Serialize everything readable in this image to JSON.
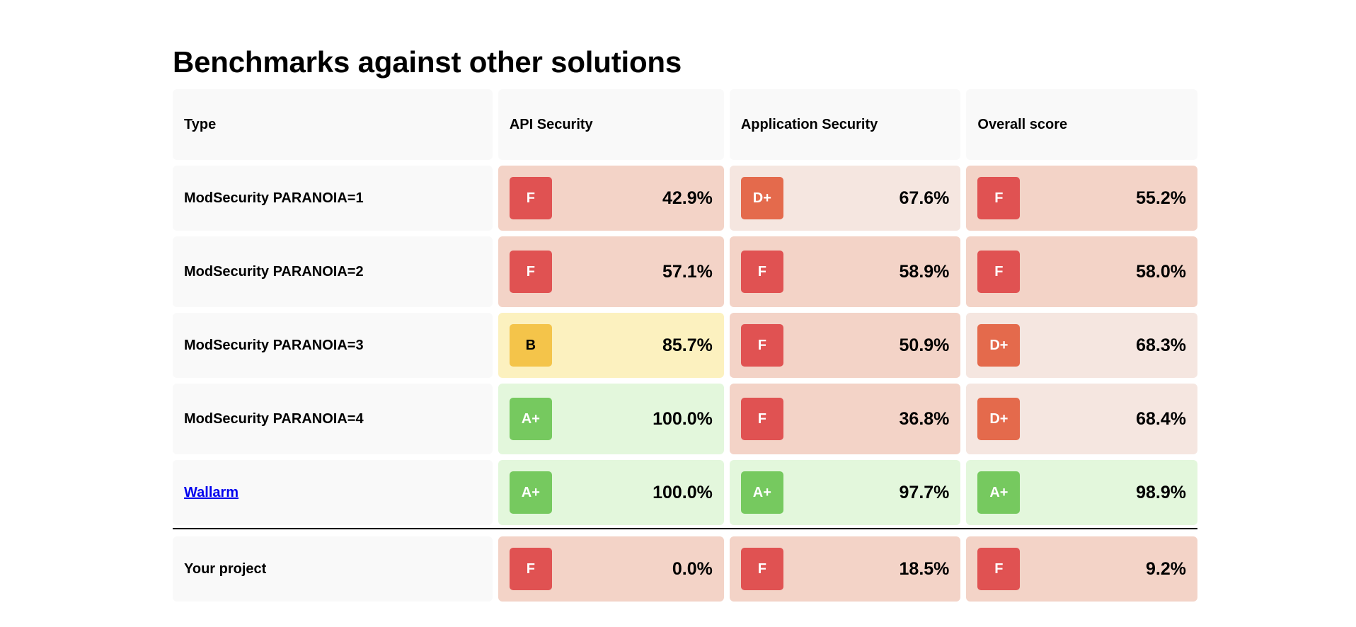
{
  "title": "Benchmarks against other solutions",
  "columns": [
    "Type",
    "API Security",
    "Application Security",
    "Overall score"
  ],
  "rows": [
    {
      "type": "ModSecurity PARANOIA=1",
      "api": {
        "grade": "F",
        "pct": "42.9%"
      },
      "app": {
        "grade": "D+",
        "pct": "67.6%"
      },
      "overall": {
        "grade": "F",
        "pct": "55.2%"
      }
    },
    {
      "type": "ModSecurity PARANOIA=2",
      "api": {
        "grade": "F",
        "pct": "57.1%"
      },
      "app": {
        "grade": "F",
        "pct": "58.9%"
      },
      "overall": {
        "grade": "F",
        "pct": "58.0%"
      }
    },
    {
      "type": "ModSecurity PARANOIA=3",
      "api": {
        "grade": "B",
        "pct": "85.7%"
      },
      "app": {
        "grade": "F",
        "pct": "50.9%"
      },
      "overall": {
        "grade": "D+",
        "pct": "68.3%"
      }
    },
    {
      "type": "ModSecurity PARANOIA=4",
      "api": {
        "grade": "A+",
        "pct": "100.0%"
      },
      "app": {
        "grade": "F",
        "pct": "36.8%"
      },
      "overall": {
        "grade": "D+",
        "pct": "68.4%"
      }
    },
    {
      "type": "Wallarm",
      "api": {
        "grade": "A+",
        "pct": "100.0%"
      },
      "app": {
        "grade": "A+",
        "pct": "97.7%"
      },
      "overall": {
        "grade": "A+",
        "pct": "98.9%"
      }
    }
  ],
  "project": {
    "type": "Your project",
    "api": {
      "grade": "F",
      "pct": "0.0%"
    },
    "app": {
      "grade": "F",
      "pct": "18.5%"
    },
    "overall": {
      "grade": "F",
      "pct": "9.2%"
    }
  },
  "colors": {
    "grade_F": "#e05252",
    "grade_D": "#e46a4c",
    "grade_B": "#f4c44a",
    "grade_A": "#76c95f",
    "cell_F": "#f3d3c7",
    "cell_D": "#f5e6e0",
    "cell_B": "#fcf1bf",
    "cell_A": "#e3f7dc",
    "link": "#0000ee"
  }
}
